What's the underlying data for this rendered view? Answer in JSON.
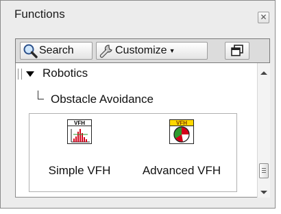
{
  "palette": {
    "title": "Functions",
    "close_icon": "close-x-icon"
  },
  "toolbar": {
    "search_label": "Search",
    "search_icon": "magnifier-icon",
    "customize_label": "Customize",
    "customize_icon": "wrench-icon",
    "view_icon": "palette-view-icon"
  },
  "tree": {
    "category": "Robotics",
    "subcategory": "Obstacle Avoidance"
  },
  "functions": [
    {
      "icon_text": "VFH",
      "label": "Simple VFH"
    },
    {
      "icon_text": "VFH",
      "label": "Advanced VFH"
    }
  ],
  "colors": {
    "adv_icon_header": "#ffd800",
    "histogram_red": "#d4001a",
    "pie_green": "#2e9a2e"
  }
}
